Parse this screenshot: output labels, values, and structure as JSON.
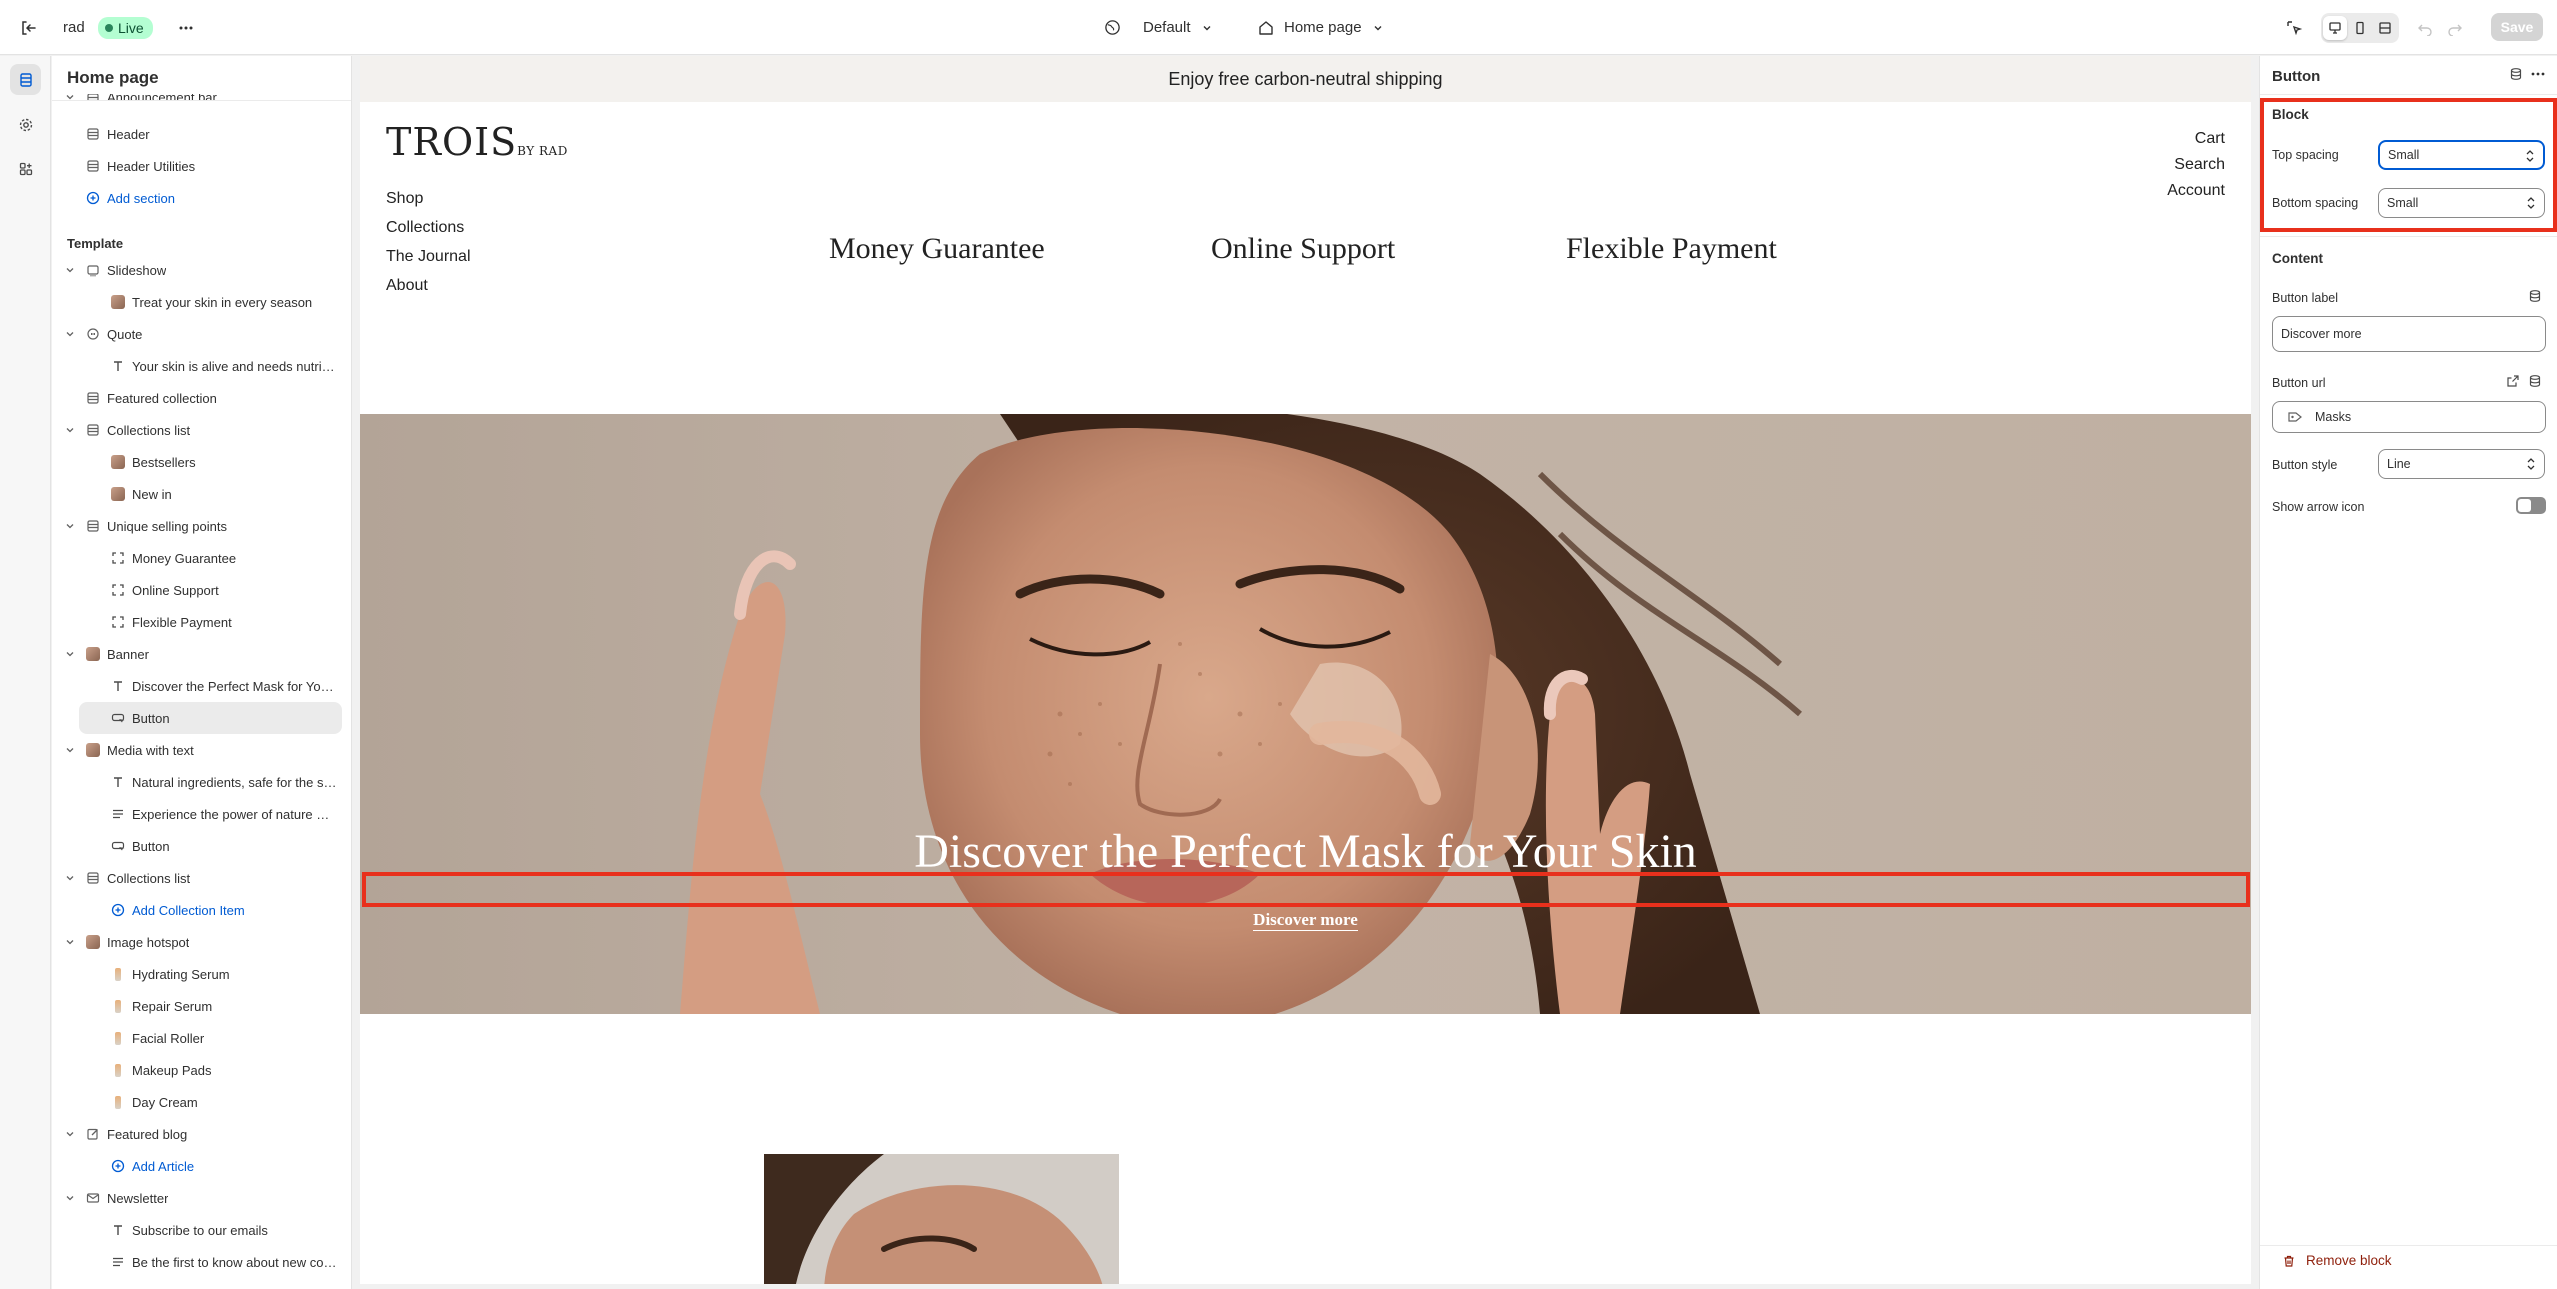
{
  "topbar": {
    "store_name": "rad",
    "live_label": "Live",
    "theme_label": "Default",
    "page_label": "Home page",
    "save_label": "Save"
  },
  "sidebar": {
    "title": "Home page",
    "header_items": [
      {
        "label": "Announcement bar"
      },
      {
        "label": "Header"
      },
      {
        "label": "Header Utilities"
      }
    ],
    "add_section_label": "Add section",
    "template_heading": "Template",
    "tree": [
      {
        "label": "Slideshow",
        "level": 0,
        "icon": "slideshow-icon",
        "expand": true
      },
      {
        "label": "Treat your skin in every season",
        "level": 1,
        "icon": "image-thumb"
      },
      {
        "label": "Quote",
        "level": 0,
        "icon": "quote-icon",
        "expand": true
      },
      {
        "label": "Your skin is alive and needs nutritio...",
        "level": 1,
        "icon": "text-icon"
      },
      {
        "label": "Featured collection",
        "level": 0,
        "icon": "section-icon",
        "expand": false
      },
      {
        "label": "Collections list",
        "level": 0,
        "icon": "section-icon",
        "expand": true
      },
      {
        "label": "Bestsellers",
        "level": 1,
        "icon": "image-thumb"
      },
      {
        "label": "New in",
        "level": 1,
        "icon": "image-thumb"
      },
      {
        "label": "Unique selling points",
        "level": 0,
        "icon": "section-icon",
        "expand": true
      },
      {
        "label": "Money Guarantee",
        "level": 1,
        "icon": "block-icon"
      },
      {
        "label": "Online Support",
        "level": 1,
        "icon": "block-icon"
      },
      {
        "label": "Flexible Payment",
        "level": 1,
        "icon": "block-icon"
      },
      {
        "label": "Banner",
        "level": 0,
        "icon": "image-thumb",
        "expand": true
      },
      {
        "label": "Discover the Perfect Mask for Your...",
        "level": 1,
        "icon": "text-icon"
      },
      {
        "label": "Button",
        "level": 1,
        "icon": "button-icon",
        "selected": true
      },
      {
        "label": "Media with text",
        "level": 0,
        "icon": "image-thumb",
        "expand": true
      },
      {
        "label": "Natural ingredients, safe for the skin",
        "level": 1,
        "icon": "text-icon"
      },
      {
        "label": "Experience the power of nature wit...",
        "level": 1,
        "icon": "paragraph-icon"
      },
      {
        "label": "Button",
        "level": 1,
        "icon": "button-icon"
      },
      {
        "label": "Collections list",
        "level": 0,
        "icon": "section-icon",
        "expand": true
      },
      {
        "label": "Add Collection Item",
        "level": 1,
        "icon": "add-icon",
        "blue": true
      },
      {
        "label": "Image hotspot",
        "level": 0,
        "icon": "image-thumb",
        "expand": true
      },
      {
        "label": "Hydrating Serum",
        "level": 1,
        "icon": "product-thumb"
      },
      {
        "label": "Repair Serum",
        "level": 1,
        "icon": "product-thumb"
      },
      {
        "label": "Facial Roller",
        "level": 1,
        "icon": "product-thumb"
      },
      {
        "label": "Makeup Pads",
        "level": 1,
        "icon": "product-thumb"
      },
      {
        "label": "Day Cream",
        "level": 1,
        "icon": "product-thumb"
      },
      {
        "label": "Featured blog",
        "level": 0,
        "icon": "blog-icon",
        "expand": true
      },
      {
        "label": "Add Article",
        "level": 1,
        "icon": "add-icon",
        "blue": true
      },
      {
        "label": "Newsletter",
        "level": 0,
        "icon": "mail-icon",
        "expand": true
      },
      {
        "label": "Subscribe to our emails",
        "level": 1,
        "icon": "text-icon"
      },
      {
        "label": "Be the first to know about new coll...",
        "level": 1,
        "icon": "paragraph-icon"
      }
    ]
  },
  "preview": {
    "announcement": "Enjoy free carbon-neutral shipping",
    "logo_main": "TROIS",
    "logo_sub": "BY RAD",
    "nav_left": [
      "Shop",
      "Collections",
      "The Journal",
      "About"
    ],
    "nav_right": [
      "Cart",
      "Search",
      "Account"
    ],
    "usps": [
      "Money Guarantee",
      "Online Support",
      "Flexible Payment"
    ],
    "banner_title": "Discover the Perfect Mask for Your Skin",
    "banner_button": "Discover more"
  },
  "settings": {
    "title": "Button",
    "block_heading": "Block",
    "top_spacing_label": "Top spacing",
    "top_spacing_value": "Small",
    "bottom_spacing_label": "Bottom spacing",
    "bottom_spacing_value": "Small",
    "content_heading": "Content",
    "button_label_label": "Button label",
    "button_label_value": "Discover more",
    "button_url_label": "Button url",
    "button_url_value": "Masks",
    "button_style_label": "Button style",
    "button_style_value": "Line",
    "show_arrow_label": "Show arrow icon",
    "show_arrow_on": false,
    "remove_label": "Remove block"
  },
  "colors": {
    "accent": "#005bd3",
    "highlight": "#e8301c",
    "live_badge": "#b4fed2",
    "remove": "#8e1f0b"
  }
}
